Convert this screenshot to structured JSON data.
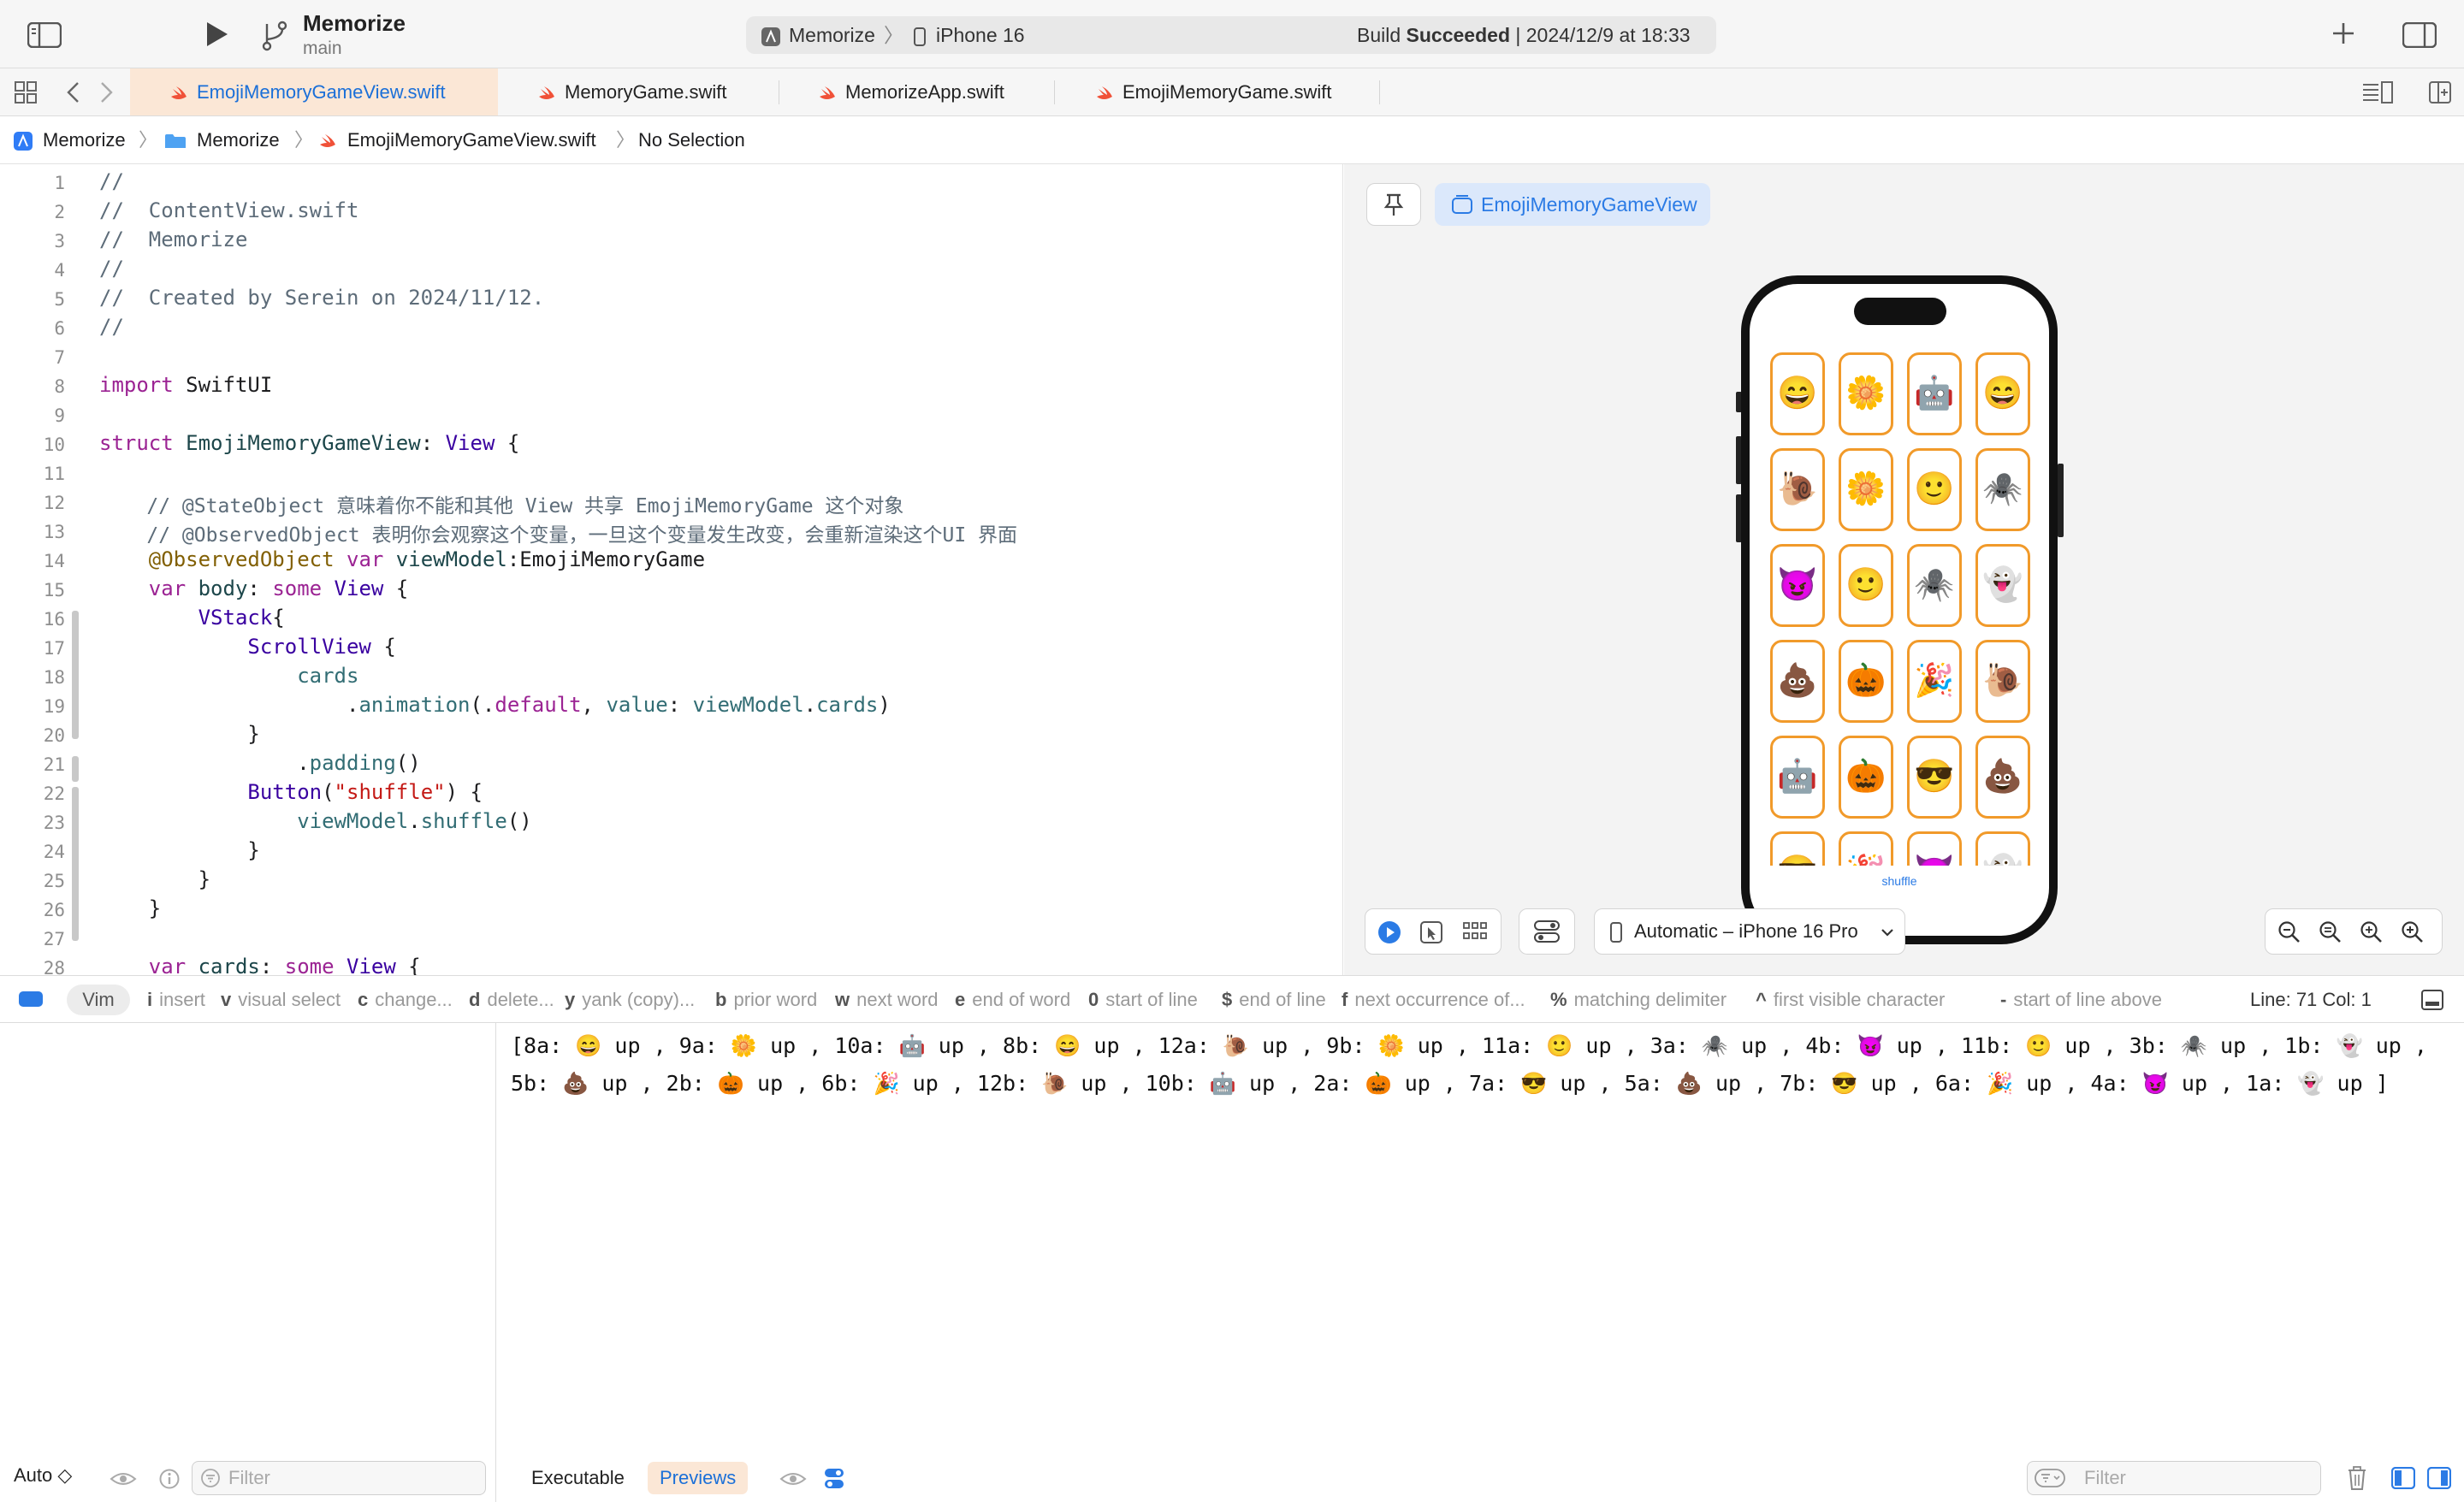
{
  "toolbar": {
    "project_name": "Memorize",
    "branch": "main",
    "scheme": "Memorize",
    "destination": "iPhone 16",
    "build_status_prefix": "Build",
    "build_status_result": "Succeeded",
    "build_status_time": "| 2024/12/9 at 18:33"
  },
  "tabs": [
    {
      "label": "EmojiMemoryGameView.swift",
      "active": true
    },
    {
      "label": "MemoryGame.swift",
      "active": false
    },
    {
      "label": "MemorizeApp.swift",
      "active": false
    },
    {
      "label": "EmojiMemoryGame.swift",
      "active": false
    }
  ],
  "breadcrumb": {
    "project": "Memorize",
    "folder": "Memorize",
    "file": "EmojiMemoryGameView.swift",
    "selection": "No Selection"
  },
  "editor": {
    "line_numbers": [
      "1",
      "2",
      "3",
      "4",
      "5",
      "6",
      "7",
      "8",
      "9",
      "10",
      "11",
      "12",
      "13",
      "14",
      "15",
      "16",
      "17",
      "18",
      "19",
      "20",
      "21",
      "22",
      "23",
      "24",
      "25",
      "26",
      "27",
      "28"
    ],
    "code": {
      "l1": "//",
      "l2": "//  ContentView.swift",
      "l3": "//  Memorize",
      "l4": "//",
      "l5": "//  Created by Serein on 2024/11/12.",
      "l6": "//",
      "l8_kw": "import",
      "l8_rest": " SwiftUI",
      "l10_kw": "struct",
      "l10_name": " EmojiMemoryGameView",
      "l10_colon": ": ",
      "l10_type": "View",
      "l10_brace": " {",
      "l12": "    // @StateObject 意味着你不能和其他 View 共享 EmojiMemoryGame 这个对象",
      "l13": "    // @ObservedObject 表明你会观察这个变量，一旦这个变量发生改变，会重新渲染这个UI 界面",
      "l14_attr": "    @ObservedObject",
      "l14_kw": " var",
      "l14_name": " viewModel",
      "l14_rest": ":EmojiMemoryGame",
      "l15_kw1": "    var",
      "l15_name": " body",
      "l15_colon": ": ",
      "l15_kw2": "some",
      "l15_type": " View",
      "l15_brace": " {",
      "l16_type": "        VStack",
      "l16_brace": "{",
      "l17_type": "            ScrollView",
      "l17_brace": " {",
      "l18_fn": "                cards",
      "l19_pre": "                    .",
      "l19_fn": "animation",
      "l19_p1": "(.",
      "l19_kw": "default",
      "l19_p2": ", ",
      "l19_label": "value",
      "l19_p3": ": ",
      "l19_vm": "viewModel",
      "l19_dot": ".",
      "l19_cards": "cards",
      "l19_end": ")",
      "l20": "            }",
      "l21_pre": "                .",
      "l21_fn": "padding",
      "l21_end": "()",
      "l22_type": "            Button",
      "l22_p": "(",
      "l22_str": "\"shuffle\"",
      "l22_end": ") {",
      "l23_vm": "                viewModel",
      "l23_dot": ".",
      "l23_fn": "shuffle",
      "l23_end": "()",
      "l24": "            }",
      "l25": "        }",
      "l26": "    }",
      "l28_kw1": "    var",
      "l28_name": " cards",
      "l28_colon": ": ",
      "l28_kw2": "some",
      "l28_type": " View",
      "l28_brace": " {"
    }
  },
  "preview": {
    "view_name": "EmojiMemoryGameView",
    "device_label": "Automatic – iPhone 16 Pro",
    "shuffle_label": "shuffle",
    "cards": [
      "😄",
      "🌼",
      "🤖",
      "😄",
      "🐌",
      "🌼",
      "🙂",
      "🕷️",
      "😈",
      "🙂",
      "🕷️",
      "👻",
      "💩",
      "🎃",
      "🎉",
      "🐌",
      "🤖",
      "🎃",
      "😎",
      "💩",
      "😎",
      "🎉",
      "😈",
      "👻"
    ]
  },
  "vim": {
    "mode": "Vim",
    "hints": [
      {
        "key": "i",
        "text": "insert"
      },
      {
        "key": "v",
        "text": "visual select"
      },
      {
        "key": "c",
        "text": "change..."
      },
      {
        "key": "d",
        "text": "delete..."
      },
      {
        "key": "y",
        "text": "yank (copy)..."
      },
      {
        "key": "b",
        "text": "prior word"
      },
      {
        "key": "w",
        "text": "next word"
      },
      {
        "key": "e",
        "text": "end of word"
      },
      {
        "key": "0",
        "text": "start of line"
      },
      {
        "key": "$",
        "text": "end of line"
      },
      {
        "key": "f",
        "text": "next occurrence of..."
      },
      {
        "key": "%",
        "text": "matching delimiter"
      },
      {
        "key": "^",
        "text": "first visible character"
      },
      {
        "key": "-",
        "text": "start of line above"
      }
    ],
    "line_col": "Line: 71  Col: 1"
  },
  "console": {
    "line1": "[8a: 😄 up , 9a: 🌼 up , 10a: 🤖 up , 8b: 😄 up , 12a: 🐌 up , 9b: 🌼 up , 11a: 🙂 up , 3a: 🕷️ up , 4b: 😈 up , 11b: 🙂 up , 3b: 🕷️ up , 1b: 👻 up ,",
    "line2": "5b: 💩 up , 2b: 🎃 up , 6b: 🎉 up , 12b: 🐌 up , 10b: 🤖 up , 2a: 🎃 up , 7a: 😎 up , 5a: 💩 up , 7b: 😎 up , 6a: 🎉 up , 4a: 😈 up , 1a: 👻 up ]",
    "executable_label": "Executable",
    "previews_label": "Previews",
    "filter_placeholder": "Filter"
  },
  "variables": {
    "scope": "Auto ◇",
    "filter_placeholder": "Filter"
  },
  "colors": {
    "accent": "#1a6fd8",
    "card_border": "#f19a2a",
    "active_tab": "#fbe7d6"
  }
}
